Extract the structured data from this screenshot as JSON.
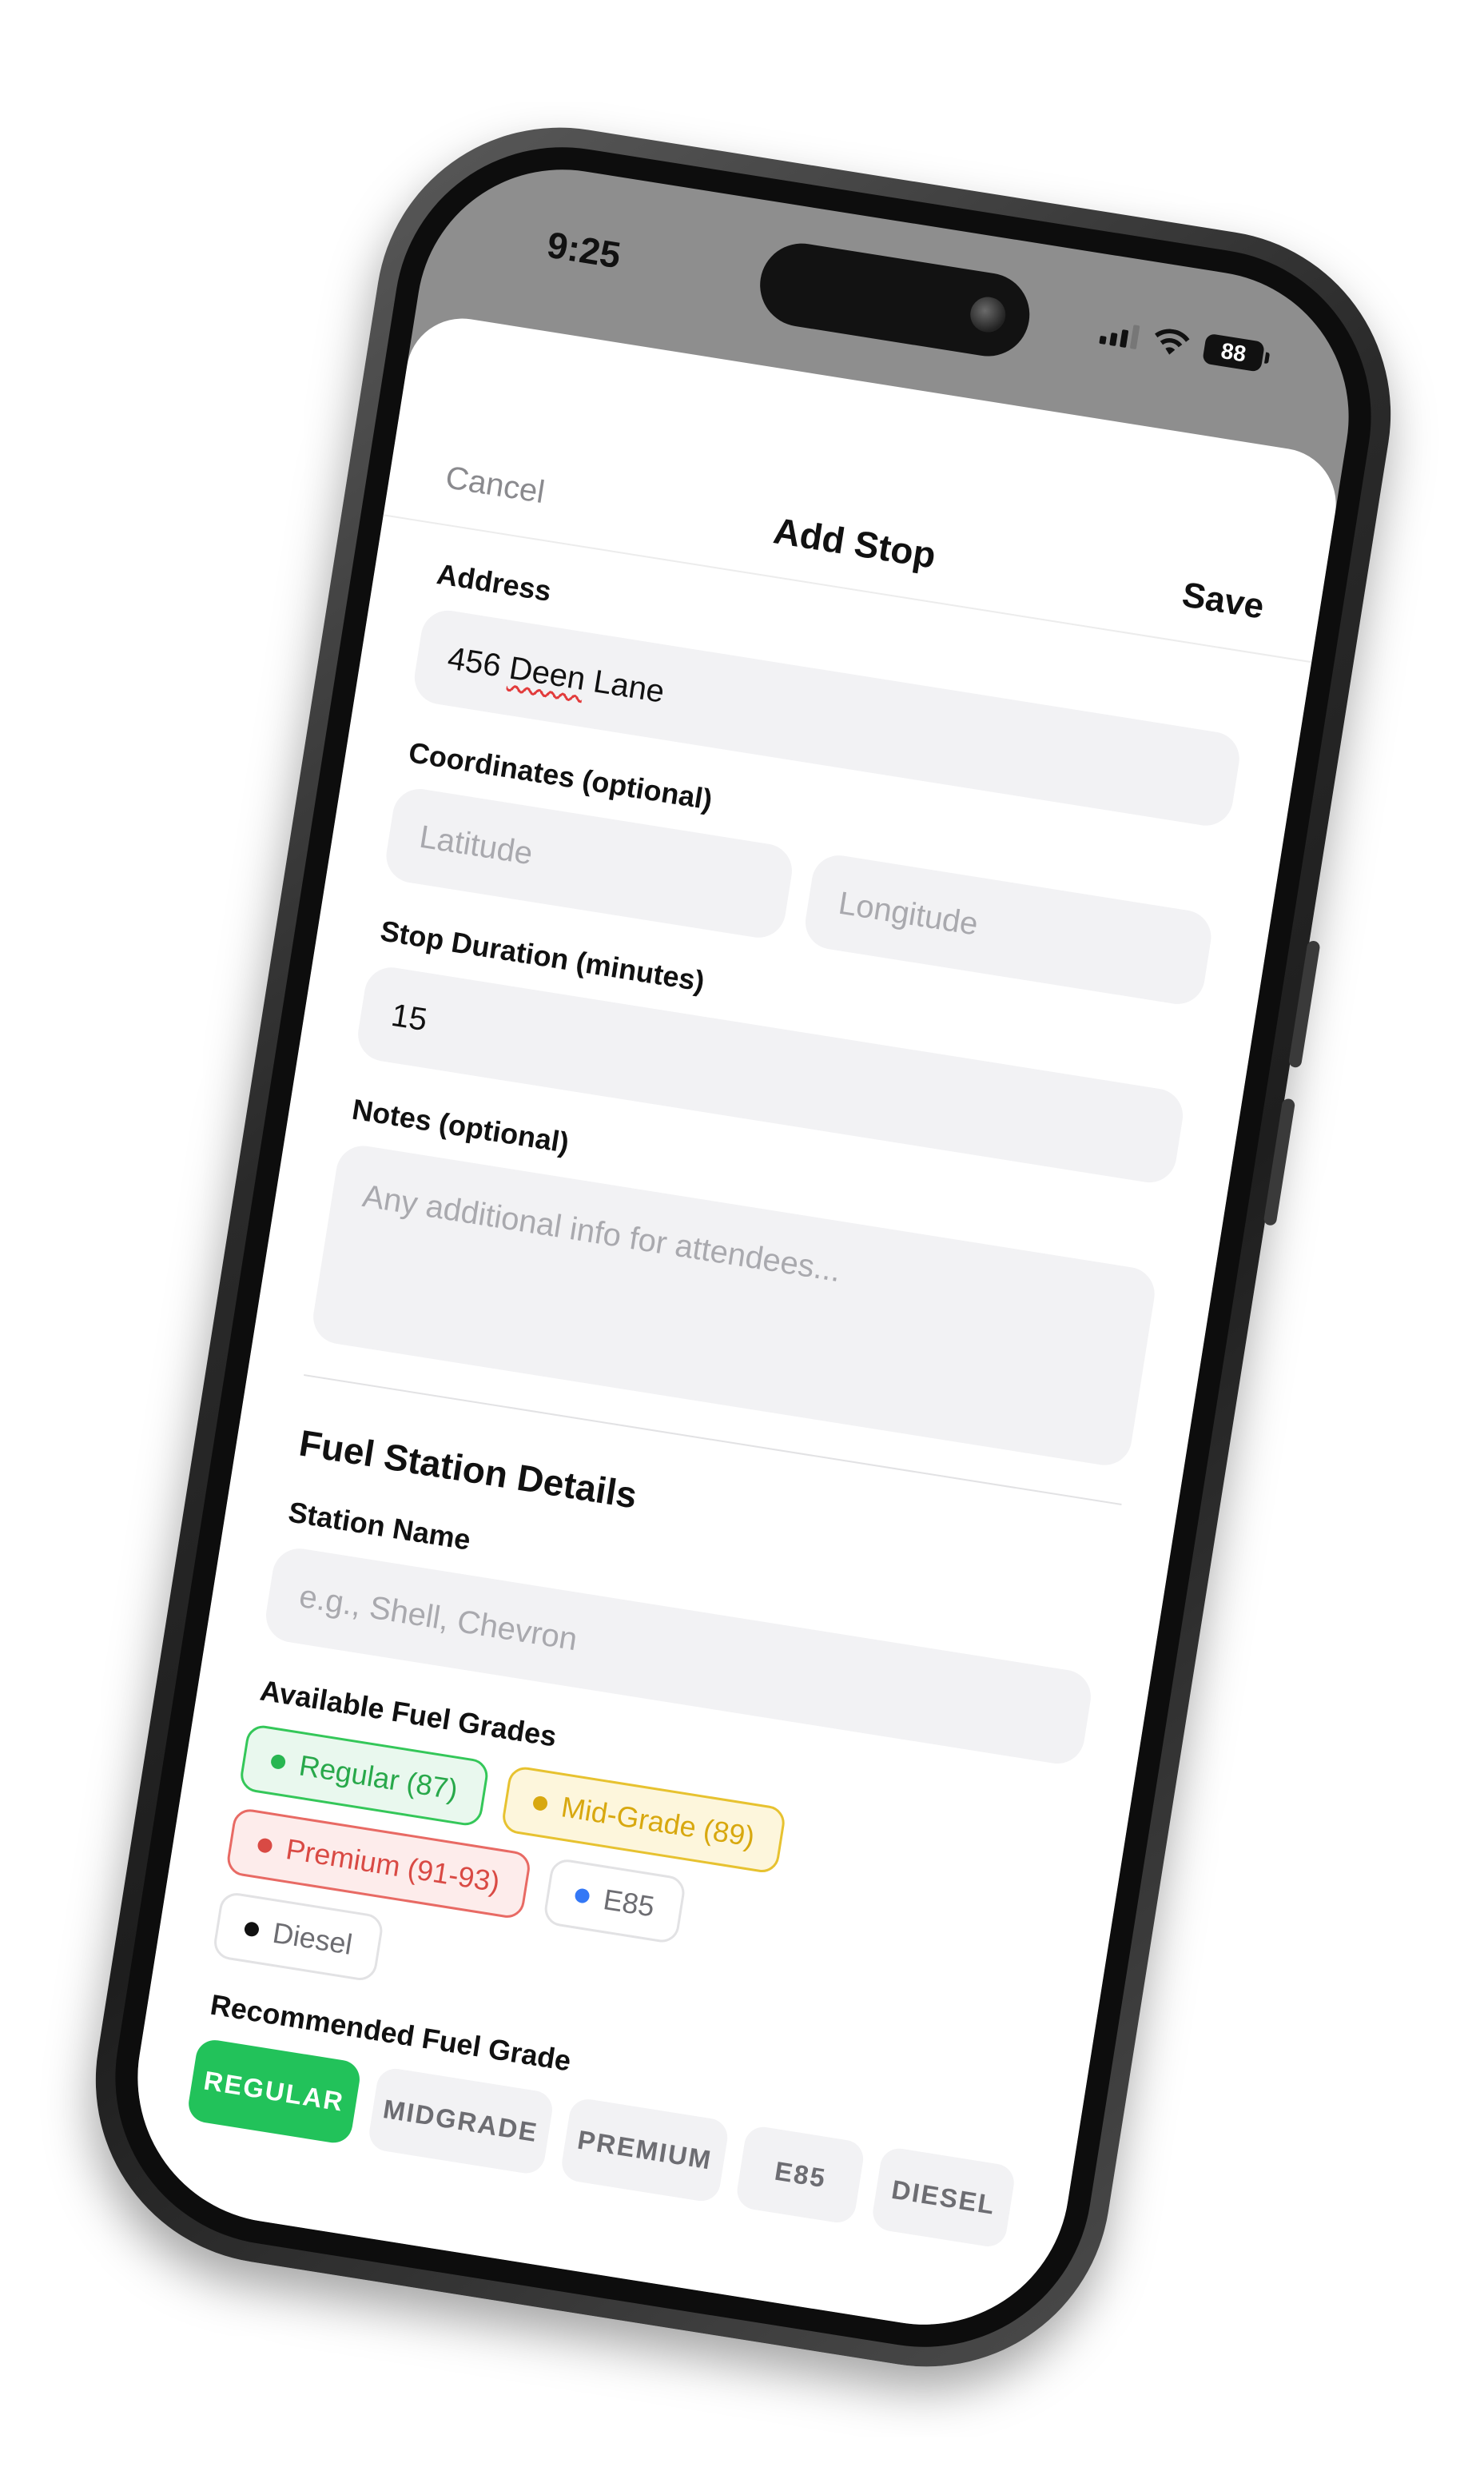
{
  "status_bar": {
    "time": "9:25",
    "battery": "88"
  },
  "nav": {
    "cancel_label": "Cancel",
    "title": "Add Stop",
    "save_label": "Save"
  },
  "form": {
    "address_label": "Address",
    "address_value_prefix": "456 ",
    "address_value_misspelled": "Deen",
    "address_value_suffix": " Lane",
    "coordinates_label": "Coordinates (optional)",
    "latitude_placeholder": "Latitude",
    "longitude_placeholder": "Longitude",
    "duration_label": "Stop Duration (minutes)",
    "duration_value": "15",
    "notes_label": "Notes (optional)",
    "notes_placeholder": "Any additional info for attendees..."
  },
  "fuel": {
    "section_title": "Fuel Station Details",
    "station_name_label": "Station Name",
    "station_name_placeholder": "e.g., Shell, Chevron",
    "available_grades_label": "Available Fuel Grades",
    "available_grades": [
      {
        "label": "Regular (87)",
        "color": "#28b651"
      },
      {
        "label": "Mid-Grade (89)",
        "color": "#d8a80f"
      },
      {
        "label": "Premium (91-93)",
        "color": "#d94a44"
      },
      {
        "label": "E85",
        "color": "#3478f6"
      },
      {
        "label": "Diesel",
        "color": "#111111"
      }
    ],
    "recommended_label": "Recommended Fuel Grade",
    "recommended_options": [
      "REGULAR",
      "MIDGRADE",
      "PREMIUM",
      "E85",
      "DIESEL"
    ],
    "recommended_selected": "REGULAR",
    "selected_color": "#22c25a"
  }
}
